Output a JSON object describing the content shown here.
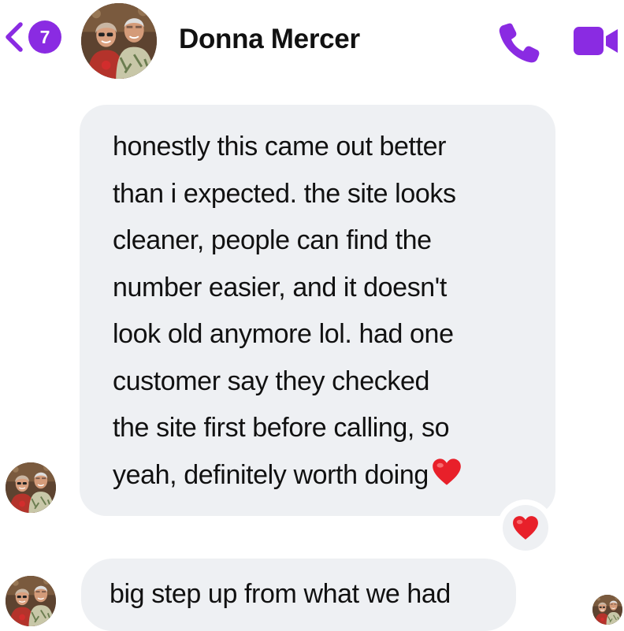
{
  "header": {
    "unread_count": "7",
    "contact_name": "Donna Mercer",
    "back_icon": "chevron-left-icon",
    "call_icon": "phone-icon",
    "video_icon": "video-camera-icon"
  },
  "colors": {
    "accent": "#8a2be2",
    "bubble_bg": "#eef0f3",
    "heart": "#e8202a"
  },
  "messages": [
    {
      "sender": "contact",
      "text": "honestly this came out better\nthan i expected. the site looks\ncleaner, people can find the\nnumber easier, and it doesn't\nlook old anymore lol. had one\ncustomer say they checked\nthe site first before calling, so\nyeah, definitely worth doing",
      "emoji": "red-heart",
      "reaction": "red-heart"
    },
    {
      "sender": "contact",
      "text": "big step up from what we had",
      "read_receipt": "avatar"
    }
  ]
}
